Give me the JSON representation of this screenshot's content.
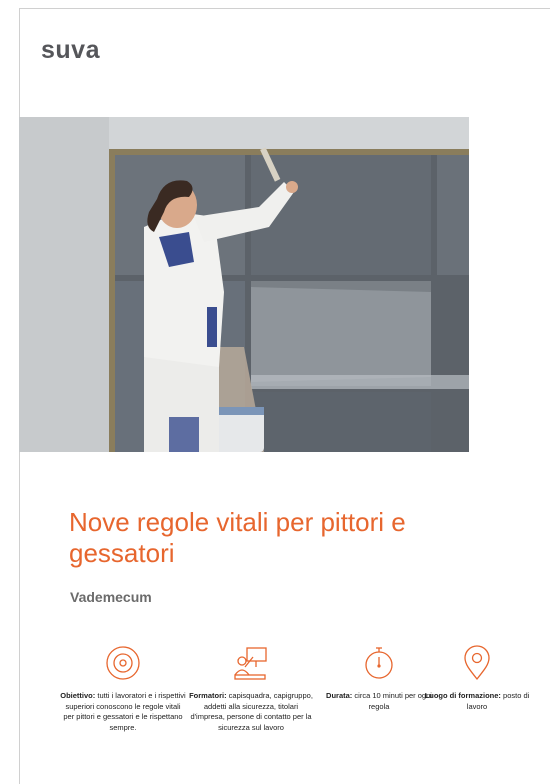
{
  "brand": {
    "logo_text": "suva",
    "accent": "#e7662e"
  },
  "cover": {
    "title": "Nove regole vitali per pittori e gessatori",
    "subtitle": "Vademecum"
  },
  "info": [
    {
      "icon": "target-icon",
      "label": "Obiettivo:",
      "text": "tutti i lavoratori e i rispettivi superiori conoscono le regole vitali per pittori e gessatori e le rispettano sempre."
    },
    {
      "icon": "trainer-icon",
      "label": "Formatori:",
      "text": "capisquadra, capigruppo, addetti alla sicurezza, titolari d'impresa, persone di contatto per la sicurezza sul lavoro"
    },
    {
      "icon": "stopwatch-icon",
      "label": "Durata:",
      "text": "circa 10 minuti per ogni regola"
    },
    {
      "icon": "location-pin-icon",
      "label": "Luogo di formazione:",
      "text": "posto di lavoro"
    }
  ]
}
